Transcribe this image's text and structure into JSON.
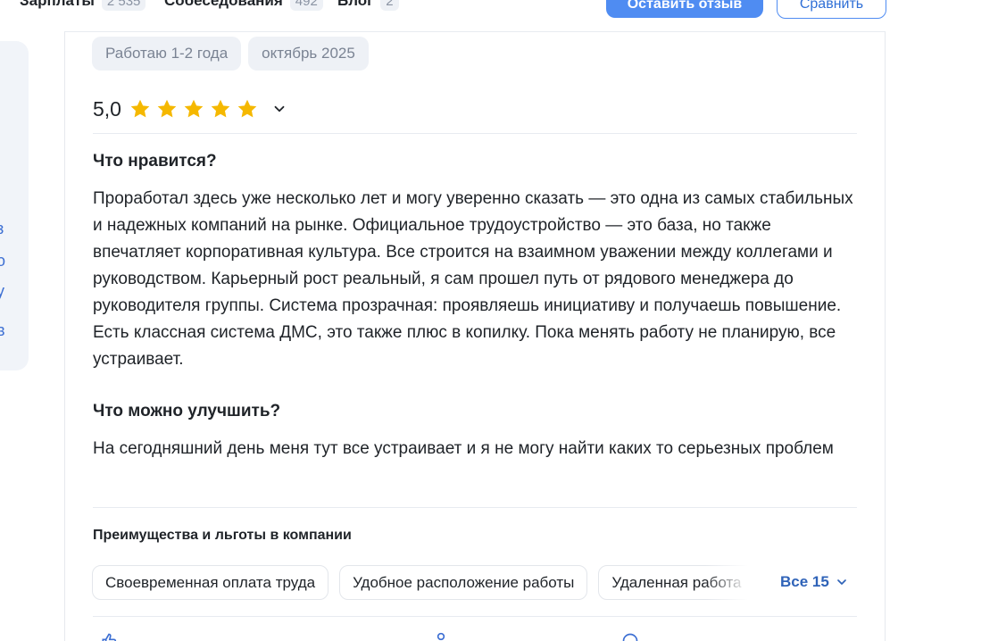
{
  "nav": {
    "items": [
      {
        "label": "Зарплаты",
        "count": "2 535"
      },
      {
        "label": "Собеседования",
        "count": "492"
      },
      {
        "label": "Блог",
        "count": "2"
      }
    ],
    "review_button": "Оставить отзыв",
    "compare_button": "Сравнить"
  },
  "review": {
    "tags": [
      "Работаю 1-2 года",
      "октябрь 2025"
    ],
    "rating": "5,0",
    "stars": 5,
    "likes_title": "Что нравится?",
    "likes_text": "Проработал здесь уже несколько лет и могу уверенно сказать — это одна из самых стабильных и надежных компаний на рынке. Официальное трудоустройство — это база, но также впечатляет корпоративная культура. Все строится на взаимном уважении между коллегами и руководством. Карьерный рост реальный, я сам прошел путь от рядового менеджера до руководителя группы. Система прозрачная: проявляешь инициативу и получаешь повышение. Есть классная система ДМС, это также плюс в копилку. Пока менять работу не планирую, все устраивает.",
    "improve_title": "Что можно улучшить?",
    "improve_text": "На сегодняшний день меня тут все устраивает и я не могу найти каких то серьезных проблем",
    "benefits_title": "Преимущества и льготы в компании",
    "benefits": [
      "Своевременная оплата труда",
      "Удобное расположение работы",
      "Удаленная работа"
    ],
    "all_benefits_label": "Все 15"
  },
  "colors": {
    "accent": "#4f8cf2",
    "link": "#2f63b8",
    "star": "#f5b800",
    "chip_bg": "#eef1f6"
  }
}
